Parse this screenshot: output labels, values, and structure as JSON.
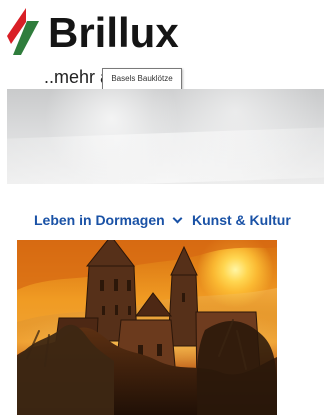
{
  "ad": {
    "brand_name": "Brillux",
    "tagline": "..mehr als Farbe",
    "tooltip": "Basels Bauklötze",
    "colors": {
      "red": "#d91f26",
      "green": "#2f7d3c",
      "text": "#151515"
    }
  },
  "navigation": {
    "items": [
      {
        "label": "Leben in Dormagen",
        "icon": "chevron-down-icon"
      },
      {
        "label": "Kunst & Kultur"
      }
    ],
    "color": "#1a52a6"
  },
  "featured_image": {
    "icon": "castle-sunset-image"
  }
}
